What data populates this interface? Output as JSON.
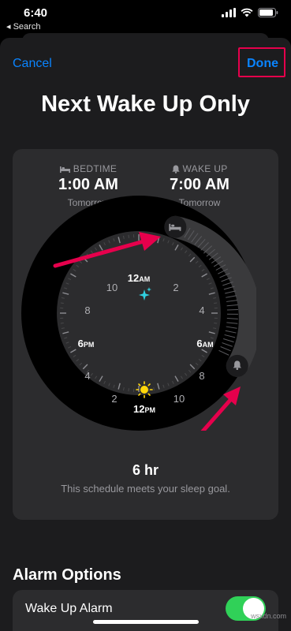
{
  "status": {
    "time": "6:40",
    "back_label": "◂ Search"
  },
  "nav": {
    "cancel": "Cancel",
    "done": "Done"
  },
  "title": "Next Wake Up Only",
  "bedtime": {
    "label": "BEDTIME",
    "time": "1:00 AM",
    "day": "Tomorrow"
  },
  "wakeup": {
    "label": "WAKE UP",
    "time": "7:00 AM",
    "day": "Tomorrow"
  },
  "clock": {
    "labels": {
      "n12": "12",
      "am_suffix": "AM",
      "h2t": "2",
      "h4r": "4",
      "h6r": "6",
      "h8r": "8",
      "h10b": "10",
      "n12b": "12",
      "pm_suffix": "PM",
      "h2b": "2",
      "h4l": "4",
      "h6l": "6",
      "h8l": "8",
      "h10t": "10"
    }
  },
  "duration": "6 hr",
  "goal_message": "This schedule meets your sleep goal.",
  "alarm_section": {
    "title": "Alarm Options",
    "wake_up_alarm_label": "Wake Up Alarm",
    "wake_up_alarm_on": true
  },
  "watermark": "wsxdn.com",
  "colors": {
    "accent": "#0a84ff",
    "toggle_on": "#30d158",
    "annotation": "#e6004c",
    "sun": "#ffd60a",
    "stars": "#30d0e0"
  }
}
